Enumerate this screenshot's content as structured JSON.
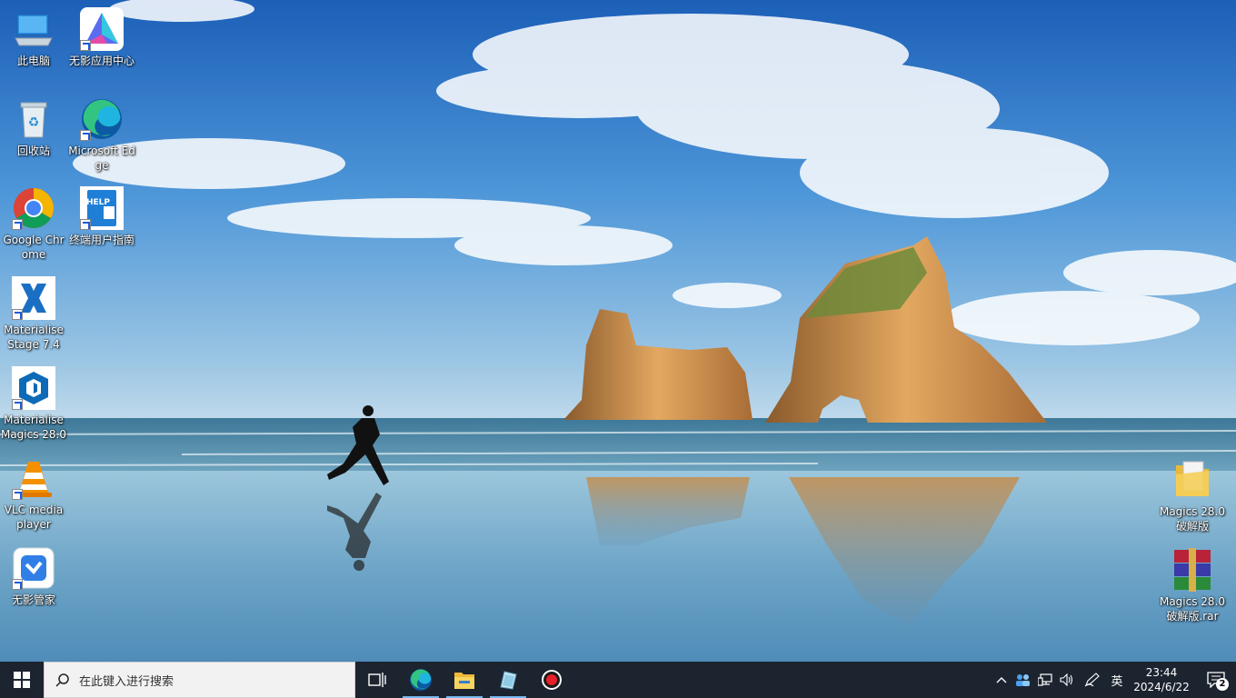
{
  "desktop": {
    "icons": [
      {
        "label": "此电脑",
        "icon": "this-pc-icon"
      },
      {
        "label": "回收站",
        "icon": "recycle-bin-icon"
      },
      {
        "label": "Google Chrome",
        "icon": "chrome-icon"
      },
      {
        "label": "Materialise Stage 7.4",
        "icon": "materialise-stage-icon"
      },
      {
        "label": "Materialise Magics 28.0",
        "icon": "materialise-magics-icon"
      },
      {
        "label": "VLC media player",
        "icon": "vlc-icon"
      },
      {
        "label": "无影管家",
        "icon": "wuying-manager-icon"
      },
      {
        "label": "无影应用中心",
        "icon": "wuying-app-center-icon"
      },
      {
        "label": "Microsoft Edge",
        "icon": "edge-icon"
      },
      {
        "label": "终端用户指南",
        "icon": "user-guide-icon"
      },
      {
        "label": "Magics 28.0 破解版",
        "icon": "folder-icon"
      },
      {
        "label": "Magics 28.0 破解版.rar",
        "icon": "winrar-archive-icon"
      }
    ]
  },
  "taskbar": {
    "search_placeholder": "在此键入进行搜索",
    "pinned": [
      "edge-icon",
      "file-explorer-icon",
      "app-icon",
      "record-icon"
    ],
    "tray": {
      "ime": "英",
      "time": "23:44",
      "date": "2024/6/22",
      "notification_count": "2"
    }
  },
  "colors": {
    "taskbar": "#1c2430",
    "accent": "#76b9ed"
  }
}
